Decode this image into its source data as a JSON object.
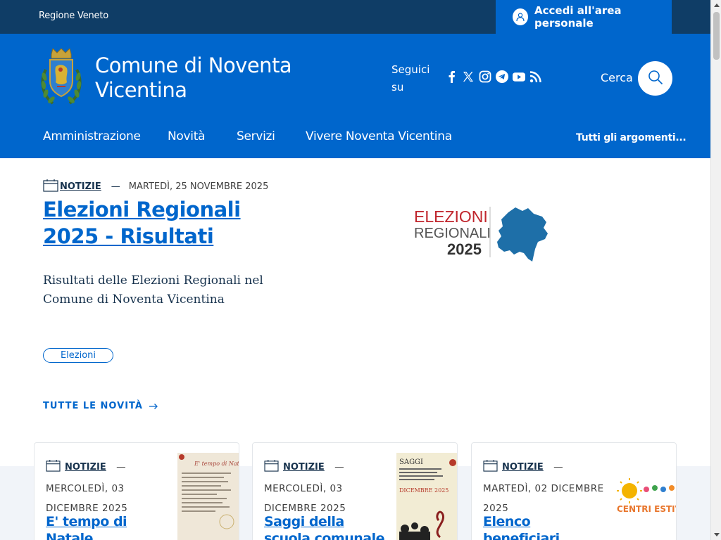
{
  "topbar": {
    "region_label": "Regione Veneto",
    "login_label": "Accedi all'area personale",
    "login_icon": "user-icon"
  },
  "header": {
    "site_name": "Comune di Noventa Vicentina",
    "follow_label": "Seguici su",
    "social_icons": [
      "facebook-icon",
      "x-twitter-icon",
      "instagram-icon",
      "telegram-icon",
      "youtube-icon",
      "rss-icon"
    ],
    "search_label": "Cerca",
    "search_icon": "search-icon"
  },
  "nav": {
    "items": [
      "Amministrazione",
      "Novità",
      "Servizi",
      "Vivere Noventa Vicentina"
    ],
    "all_topics": "Tutti gli argomenti..."
  },
  "hero": {
    "category": "NOTIZIE",
    "date": "MARTEDÌ, 25 NOVEMBRE 2025",
    "title": "Elezioni Regionali 2025 - Risultati",
    "description": "Risultati delle Elezioni Regionali nel Comune di Noventa Vicentina",
    "tag": "Elezioni",
    "all_news": "TUTTE LE NOVITÀ",
    "image_text": {
      "line1": "ELEZIONI",
      "line2": "REGIONALI",
      "line3": "2025"
    }
  },
  "cards": [
    {
      "category": "NOTIZIE",
      "date": "MERCOLEDÌ, 03 DICEMBRE 2025",
      "title": "E' tempo di Natale"
    },
    {
      "category": "NOTIZIE",
      "date": "MERCOLEDÌ, 03 DICEMBRE 2025",
      "title": "Saggi della scuola comunale di musica"
    },
    {
      "category": "NOTIZIE",
      "date": "MARTEDÌ, 02 DICEMBRE 2025",
      "title": "Elenco beneficiari Contributi Centri"
    }
  ],
  "card_thumbs": {
    "saggi": {
      "line1": "SAGGI",
      "line2": "DICEMBRE 2025"
    },
    "centri": "CENTRI ESTIVI"
  },
  "colors": {
    "primary": "#0066cc",
    "dark": "#0f3d66",
    "text": "#17324d",
    "section_bg": "#f1f4f9",
    "elezioni_red": "#c0262d",
    "veneto_blue": "#1e6fa8"
  }
}
